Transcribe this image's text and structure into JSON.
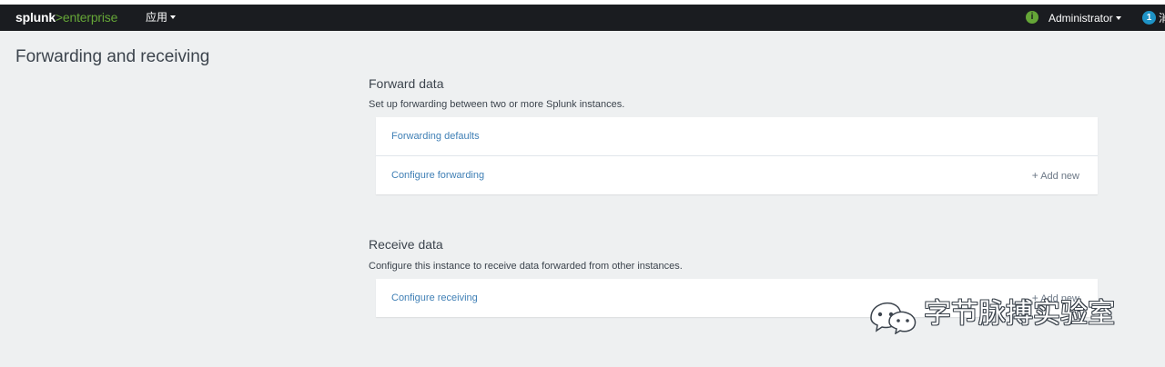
{
  "navbar": {
    "logo_part1": "splunk",
    "logo_part2": ">",
    "logo_part3": "enterprise",
    "apps_label": "应用",
    "info_icon_char": "i",
    "user_label": "Administrator",
    "messages_count": "1",
    "messages_label": "消息"
  },
  "page": {
    "title": "Forwarding and receiving"
  },
  "forward": {
    "title": "Forward data",
    "description": "Set up forwarding between two or more Splunk instances.",
    "defaults_link": "Forwarding defaults",
    "configure_link": "Configure forwarding",
    "add_new_plus": "+",
    "add_new_label": "Add new"
  },
  "receive": {
    "title": "Receive data",
    "description": "Configure this instance to receive data forwarded from other instances.",
    "configure_link": "Configure receiving",
    "add_new_plus": "+",
    "add_new_label": "Add new"
  },
  "watermark": {
    "text": "字节脉搏实验室"
  },
  "colors": {
    "navbar": "#1a1c20",
    "background": "#eef0f1",
    "link": "#3f7fb5",
    "brand_green": "#65a637",
    "badge_blue": "#1e93c6"
  }
}
